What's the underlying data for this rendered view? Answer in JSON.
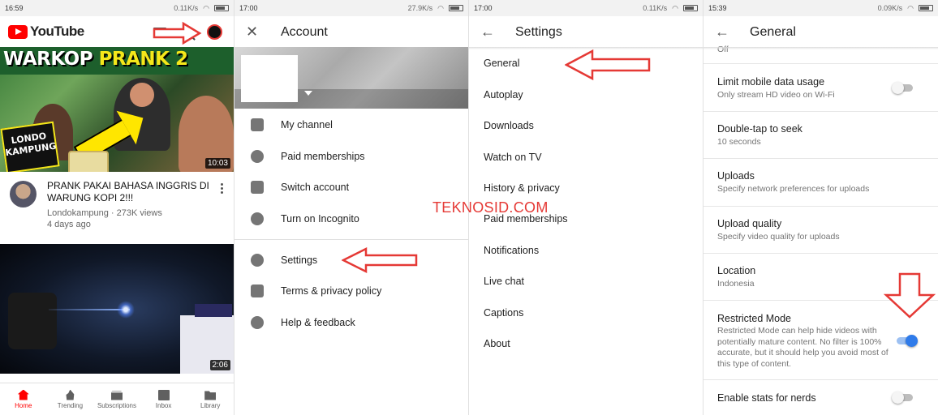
{
  "panel1": {
    "status": {
      "time": "16:59",
      "net": "0.11K/s"
    },
    "app_name": "YouTube",
    "video1": {
      "thumb_title_a": "WARKOP ",
      "thumb_title_b": "PRANK 2",
      "badge_line1": "LONDO",
      "badge_line2": "KAMPUNG",
      "duration": "10:03",
      "title": "PRANK PAKAI BAHASA INGGRIS DI WARUNG KOPI 2!!!",
      "channel_views": "Londokampung · 273K views",
      "age": "4 days ago"
    },
    "video2": {
      "duration": "2:06"
    },
    "nav": [
      {
        "label": "Home",
        "icon": "home-icon"
      },
      {
        "label": "Trending",
        "icon": "trending-icon"
      },
      {
        "label": "Subscriptions",
        "icon": "subscriptions-icon"
      },
      {
        "label": "Inbox",
        "icon": "inbox-icon"
      },
      {
        "label": "Library",
        "icon": "library-icon"
      }
    ]
  },
  "panel2": {
    "status": {
      "time": "17:00",
      "net": "27.9K/s"
    },
    "title": "Account",
    "items": [
      {
        "label": "My channel",
        "icon": "person-icon"
      },
      {
        "label": "Paid memberships",
        "icon": "dollar-icon"
      },
      {
        "label": "Switch account",
        "icon": "switch-account-icon"
      },
      {
        "label": "Turn on Incognito",
        "icon": "incognito-icon"
      },
      {
        "label": "Settings",
        "icon": "gear-icon"
      },
      {
        "label": "Terms & privacy policy",
        "icon": "lock-icon"
      },
      {
        "label": "Help & feedback",
        "icon": "help-icon"
      }
    ]
  },
  "panel3": {
    "status": {
      "time": "17:00",
      "net": "0.11K/s"
    },
    "title": "Settings",
    "items": [
      "General",
      "Autoplay",
      "Downloads",
      "Watch on TV",
      "History & privacy",
      "Paid memberships",
      "Notifications",
      "Live chat",
      "Captions",
      "About"
    ]
  },
  "panel4": {
    "status": {
      "time": "15:39",
      "net": "0.09K/s"
    },
    "title": "General",
    "top_partial": "Off",
    "rows": [
      {
        "title": "Limit mobile data usage",
        "sub": "Only stream HD video on Wi-Fi",
        "toggle": false
      },
      {
        "title": "Double-tap to seek",
        "sub": "10 seconds"
      },
      {
        "title": "Uploads",
        "sub": "Specify network preferences for uploads"
      },
      {
        "title": "Upload quality",
        "sub": "Specify video quality for uploads"
      },
      {
        "title": "Location",
        "sub": "Indonesia"
      },
      {
        "title": "Restricted Mode",
        "sub": "Restricted Mode can help hide videos with potentially mature content. No filter is 100% accurate, but it should help you avoid most of this type of content.",
        "toggle": true
      },
      {
        "title": "Enable stats for nerds",
        "toggle": false
      }
    ]
  },
  "watermark": "TEKNOSID.COM",
  "colors": {
    "accent_red": "#ff0000",
    "annotation_red": "#e53935",
    "toggle_on": "#2f7bea"
  }
}
